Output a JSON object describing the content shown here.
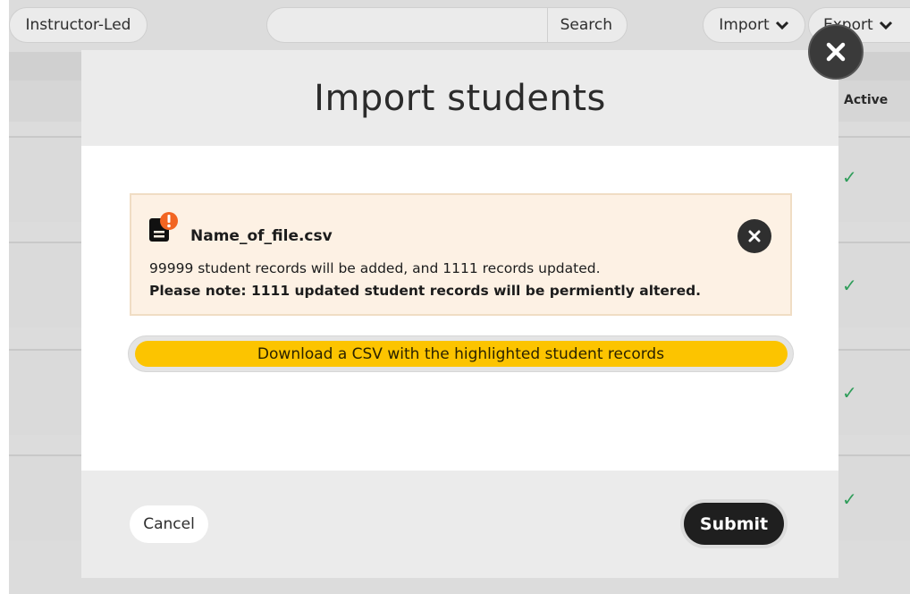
{
  "toolbar": {
    "filter_label": "Instructor-Led",
    "search_label": "Search",
    "import_label": "Import",
    "export_label": "Export"
  },
  "table": {
    "active_header": "Active",
    "active_marks": [
      "✓",
      "✓",
      "✓",
      "✓"
    ]
  },
  "modal": {
    "title": "Import students",
    "notice": {
      "file_name": "Name_of_file.csv",
      "summary": "99999 student records will be added, and 1111 records updated.",
      "warning": "Please note: 1111 updated student records will be permiently altered."
    },
    "download_label": "Download a CSV with the highlighted student records",
    "cancel_label": "Cancel",
    "submit_label": "Submit"
  },
  "colors": {
    "accent_yellow": "#fcc400",
    "notice_background": "#fdf1e4",
    "warning_orange": "#f26522",
    "check_green": "#2f9d5a"
  },
  "icons": {
    "file": "file-warning-icon",
    "close": "close-icon",
    "chevron": "chevron-down-icon",
    "check": "checkmark-icon"
  }
}
